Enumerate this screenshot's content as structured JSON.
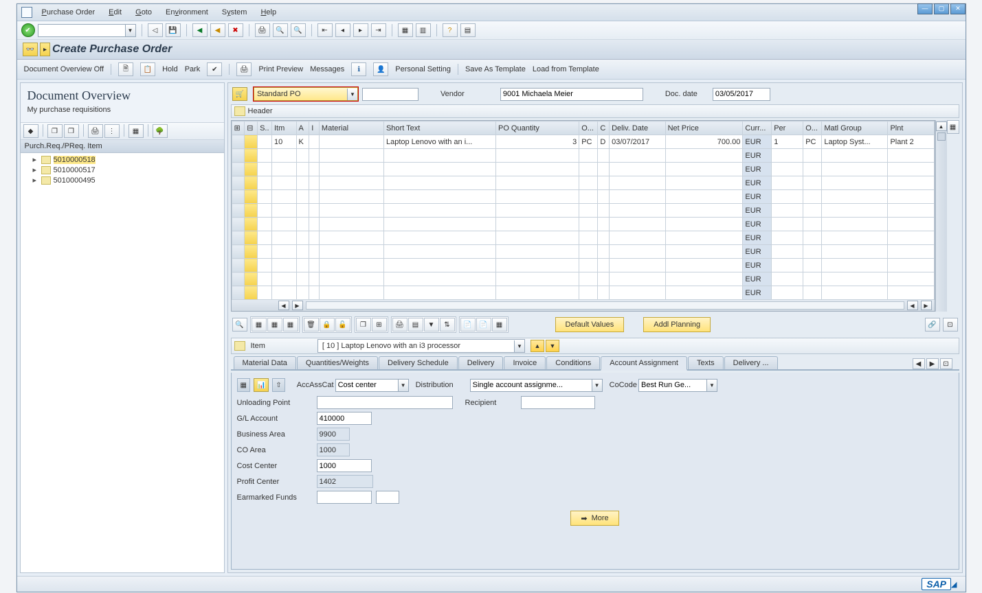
{
  "menubar": {
    "items": [
      "Purchase Order",
      "Edit",
      "Goto",
      "Environment",
      "System",
      "Help"
    ]
  },
  "window_title": "Create Purchase Order",
  "appbar": {
    "doc_overview_off": "Document Overview Off",
    "hold": "Hold",
    "park": "Park",
    "print_preview": "Print Preview",
    "messages": "Messages",
    "personal_setting": "Personal Setting",
    "save_template": "Save As Template",
    "load_template": "Load from Template"
  },
  "sidebar": {
    "title": "Document Overview",
    "subtitle": "My purchase requisitions",
    "list_header": "Purch.Req./PReq. Item",
    "items": [
      {
        "id": "5010000518",
        "selected": true
      },
      {
        "id": "5010000517",
        "selected": false
      },
      {
        "id": "5010000495",
        "selected": false
      }
    ]
  },
  "po_header": {
    "type": "Standard PO",
    "vendor_label": "Vendor",
    "vendor_value": "9001 Michaela Meier",
    "doc_date_label": "Doc. date",
    "doc_date_value": "03/05/2017",
    "header_label": "Header"
  },
  "grid": {
    "columns": [
      "S..",
      "Itm",
      "A",
      "I",
      "Material",
      "Short Text",
      "PO Quantity",
      "O...",
      "C",
      "Deliv. Date",
      "Net Price",
      "Curr...",
      "Per",
      "O...",
      "Matl Group",
      "Plnt"
    ],
    "rows": [
      {
        "itm": "10",
        "a": "K",
        "i": "",
        "material": "",
        "short_text": "Laptop Lenovo with an i...",
        "qty": "3",
        "oun": "PC",
        "c": "D",
        "deliv": "03/07/2017",
        "price": "700.00",
        "curr": "EUR",
        "per": "1",
        "o2": "PC",
        "matl": "Laptop Syst...",
        "plnt": "Plant 2"
      }
    ],
    "empty_curr": "EUR"
  },
  "midbar": {
    "default_values": "Default Values",
    "addl_planning": "Addl Planning"
  },
  "item_detail": {
    "label": "Item",
    "selected": "[ 10 ] Laptop Lenovo with an i3 processor"
  },
  "tabs": {
    "items": [
      "Material Data",
      "Quantities/Weights",
      "Delivery Schedule",
      "Delivery",
      "Invoice",
      "Conditions",
      "Account Assignment",
      "Texts",
      "Delivery ..."
    ],
    "active": "Account Assignment"
  },
  "account_form": {
    "acc_ass_cat_label": "AccAssCat",
    "acc_ass_cat_value": "Cost center",
    "distribution_label": "Distribution",
    "distribution_value": "Single account assignme...",
    "cocode_label": "CoCode",
    "cocode_value": "Best Run Ge...",
    "unloading_point_label": "Unloading Point",
    "unloading_point_value": "",
    "recipient_label": "Recipient",
    "recipient_value": "",
    "gl_account_label": "G/L Account",
    "gl_account_value": "410000",
    "business_area_label": "Business Area",
    "business_area_value": "9900",
    "co_area_label": "CO Area",
    "co_area_value": "1000",
    "cost_center_label": "Cost Center",
    "cost_center_value": "1000",
    "profit_center_label": "Profit Center",
    "profit_center_value": "1402",
    "earmarked_label": "Earmarked Funds",
    "earmarked_value": "",
    "more_label": "More"
  }
}
